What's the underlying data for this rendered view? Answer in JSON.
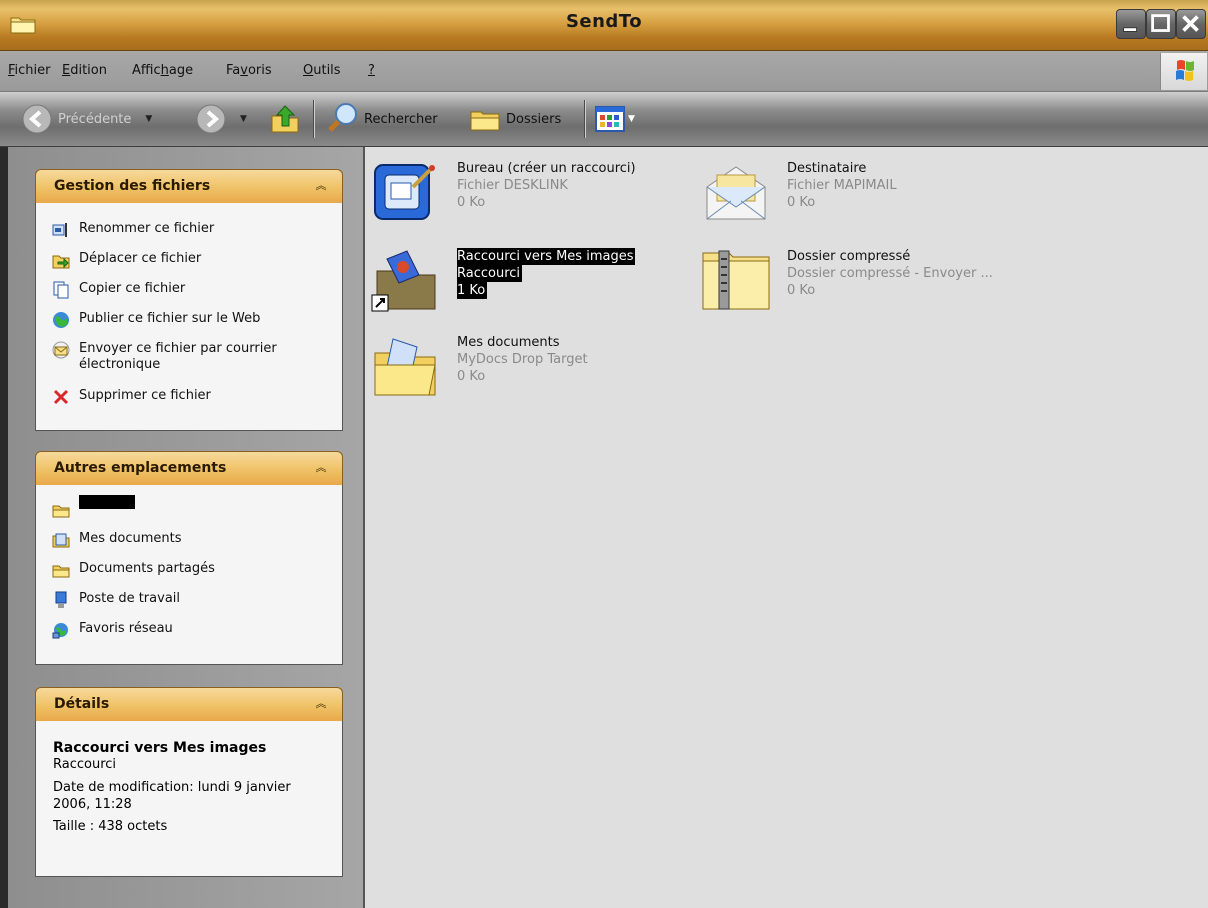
{
  "window": {
    "title": "SendTo"
  },
  "menu": {
    "items": [
      {
        "accel": "F",
        "rest": "ichier"
      },
      {
        "accel": "E",
        "rest": "dition"
      },
      {
        "pre": "Affic",
        "accel": "h",
        "rest": "age"
      },
      {
        "pre": "Fa",
        "accel": "v",
        "rest": "oris"
      },
      {
        "accel": "O",
        "rest": "utils"
      },
      {
        "accel": "?",
        "rest": ""
      }
    ]
  },
  "toolbar": {
    "back_label": "Précédente",
    "search_label": "Rechercher",
    "folders_label": "Dossiers"
  },
  "tasks_panel": {
    "title": "Gestion des fichiers",
    "items": [
      {
        "label": "Renommer ce fichier",
        "icon": "rename-icon"
      },
      {
        "label": "Déplacer ce fichier",
        "icon": "move-icon"
      },
      {
        "label": "Copier ce fichier",
        "icon": "copy-icon"
      },
      {
        "label": "Publier ce fichier sur le Web",
        "icon": "globe-icon"
      },
      {
        "label": "Envoyer ce fichier par courrier",
        "label2": "électronique",
        "icon": "mail-icon"
      },
      {
        "label": "Supprimer ce fichier",
        "icon": "delete-icon"
      }
    ]
  },
  "places_panel": {
    "title": "Autres emplacements",
    "items": [
      {
        "label": "",
        "icon": "folder-icon"
      },
      {
        "label": "Mes documents",
        "icon": "documents-icon"
      },
      {
        "label": "Documents partagés",
        "icon": "folder-icon"
      },
      {
        "label": "Poste de travail",
        "icon": "computer-icon"
      },
      {
        "label": "Favoris réseau",
        "icon": "network-icon"
      }
    ]
  },
  "details_panel": {
    "title": "Détails",
    "name": "Raccourci vers Mes images",
    "type": "Raccourci",
    "modified_line1": "Date de modification: lundi 9 janvier",
    "modified_line2": "2006, 11:28",
    "size": "Taille : 438 octets"
  },
  "files": [
    {
      "name": "Bureau (créer un raccourci)",
      "type": "Fichier DESKLINK",
      "size": "0 Ko",
      "icon": "desktop-shortcut-icon"
    },
    {
      "name": "Destinataire",
      "type": "Fichier MAPIMAIL",
      "size": "0 Ko",
      "icon": "mail-recipient-icon"
    },
    {
      "name": "Raccourci vers Mes images",
      "type": "Raccourci",
      "size": "1 Ko",
      "icon": "pictures-shortcut-icon",
      "selected": true
    },
    {
      "name": "Dossier compressé",
      "type": "Dossier compressé - Envoyer ...",
      "size": "0 Ko",
      "icon": "zip-folder-icon"
    },
    {
      "name": "Mes documents",
      "type": "MyDocs Drop Target",
      "size": "0 Ko",
      "icon": "mydocs-folder-icon"
    }
  ],
  "colors": {
    "titlebar": "#d8a244",
    "panel_header": "#f0c46a",
    "selection": "#000000"
  }
}
